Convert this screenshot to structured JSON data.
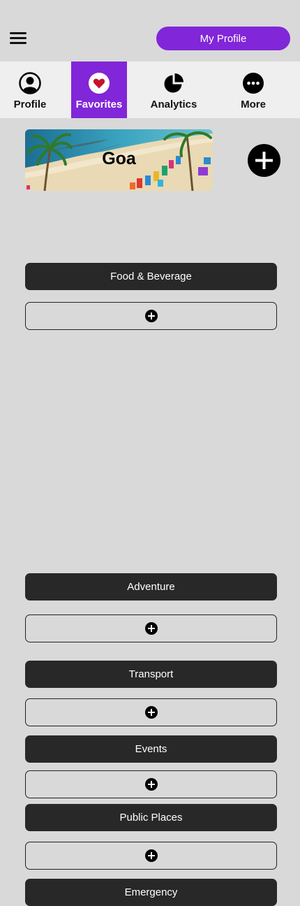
{
  "header": {
    "menu_icon": "hamburger-menu-icon",
    "profile_button_label": "My Profile"
  },
  "tabs": [
    {
      "label": "Profile",
      "icon": "user-circle-icon",
      "active": false
    },
    {
      "label": "Favorites",
      "icon": "heart-icon",
      "active": true
    },
    {
      "label": "Analytics",
      "icon": "pie-chart-icon",
      "active": false
    },
    {
      "label": "More",
      "icon": "more-dots-icon",
      "active": false
    }
  ],
  "destination": {
    "title": "Goa",
    "image": "beach-photo",
    "add_icon": "plus-circle-icon"
  },
  "categories": [
    {
      "label": "Food & Beverage"
    },
    {
      "label": "Adventure"
    },
    {
      "label": "Transport"
    },
    {
      "label": "Events"
    },
    {
      "label": "Public Places"
    },
    {
      "label": "Emergency"
    }
  ],
  "colors": {
    "accent": "#8126d8",
    "background": "#d9d9d9",
    "tab_bar": "#efefef",
    "category_bar": "#282828",
    "heart": "#c8102e"
  }
}
